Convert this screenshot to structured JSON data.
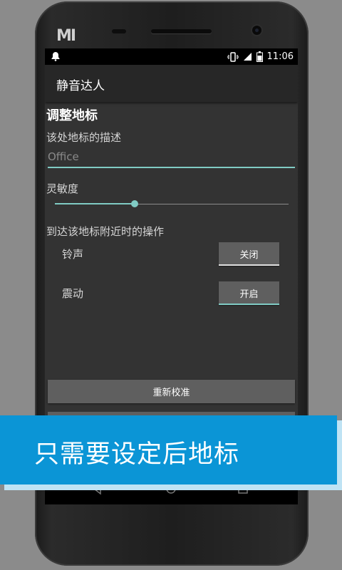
{
  "status_bar": {
    "time": "11:06"
  },
  "app": {
    "title": "静音达人"
  },
  "page": {
    "section_title": "调整地标",
    "description_label": "该处地标的描述",
    "description_placeholder": "Office",
    "sensitivity_label": "灵敏度",
    "sensitivity_value": 0.34,
    "action_label": "到达该地标附近时的操作",
    "ringtone_label": "铃声",
    "ringtone_button": "关闭",
    "vibration_label": "震动",
    "vibration_button": "开启",
    "recalibrate_button": "重新校准"
  },
  "banner": {
    "text": "只需要设定后地标"
  },
  "colors": {
    "accent": "#80cbc4",
    "banner": "#0b95d6",
    "button": "#5f5f5f",
    "off_indicator": "#e0e0e0"
  },
  "icons": [
    "notification-bell-icon",
    "vibrate-icon",
    "signal-icon",
    "battery-icon",
    "back-icon",
    "home-icon",
    "recents-icon"
  ]
}
